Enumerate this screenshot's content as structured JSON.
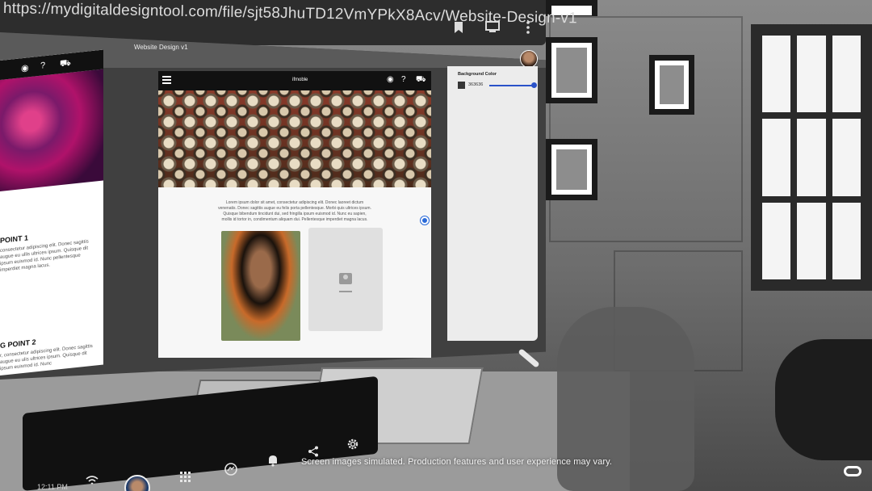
{
  "browser": {
    "url": "https://mydigitaldesigntool.com/file/sjt58JhuTD12VmYPkX8Acv/Website-Design-v1",
    "icons": [
      "bookmark-icon",
      "cast-icon",
      "more-vert-icon"
    ]
  },
  "app": {
    "document_title": "Website Design v1"
  },
  "left_page": {
    "heading_1": "POINT 1",
    "paragraph_1": "consectetur adipiscing elit. Donec sagittis augue eu ullis ultrices ipsum. Quisque dit ipsum euismod id. Nunc pellentesque imperdiet magna lacus.",
    "heading_2": "G POINT 2",
    "paragraph_2": "r, consectetur adipiscing elit. Donec sagittis augue eu ulis ultrices ipsum. Quisque dit ipsum euismod id. Nunc"
  },
  "artboard": {
    "brand": "ifmoble",
    "body_text": "Lorem ipsum dolor sit amet, consectetur adipiscing elit. Donec laoreet dictum venenatis. Donec sagittis augue eu felis porta pellentesque. Morbi quis ultrices ipsum. Quisque bibendum tincidunt dui, sed fringilla ipsum euismod id. Nunc eu sapien, mollis id tortor in, condimentum aliquam dui. Pellentesque imperdiet magna lacus."
  },
  "properties": {
    "background_color_label": "Background Color",
    "background_color_value": "363636"
  },
  "dock": {
    "time": "12:11 PM"
  },
  "disclaimer": "Screen images simulated. Production features and user experience may vary.",
  "colors": {
    "selection_blue": "#2a6ad8",
    "slider_blue": "#2a52c8"
  }
}
